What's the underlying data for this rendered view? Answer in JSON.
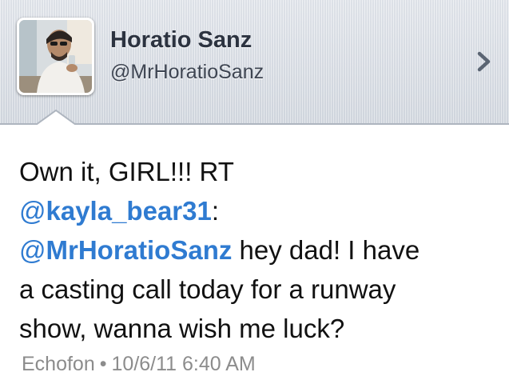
{
  "profile": {
    "name": "Horatio Sanz",
    "handle": "@MrHoratioSanz",
    "avatar_icon": "profile-photo",
    "chevron_icon": "chevron-right-icon"
  },
  "tweet": {
    "line1": "Own it, GIRL!!! RT",
    "mention1_at": "@",
    "mention1_name": "kayla_bear31",
    "mention1_suffix": ":",
    "mention2_at": "@",
    "mention2_name": "MrHoratioSanz",
    "text_after_mention2": " hey dad! I have",
    "line4": "a casting call today for a runway",
    "line5": "show, wanna wish me luck?"
  },
  "meta": {
    "source": "Echofon",
    "separator": "•",
    "timestamp": "10/6/11 6:40 AM"
  },
  "colors": {
    "mention": "#2f7bd1",
    "text": "#111111",
    "meta": "#8c8c8c",
    "header_bg": "#dde1e7"
  }
}
